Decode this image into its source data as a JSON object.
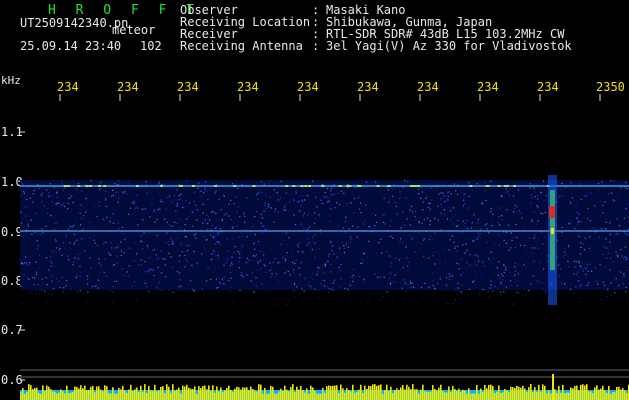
{
  "header": {
    "brand": "H R O F F T",
    "filename": "UT2509142340.pn",
    "filetype": "meteor",
    "datetime": "25.09.14 23:40",
    "count": "102"
  },
  "metadata": [
    {
      "key": "Observer",
      "sep": ":",
      "value": "Masaki Kano"
    },
    {
      "key": "Receiving Location",
      "sep": ":",
      "value": "Shibukawa, Gunma, Japan"
    },
    {
      "key": "Receiver",
      "sep": ":",
      "value": "RTL-SDR SDR# 43dB L15 103.2MHz CW"
    },
    {
      "key": "Receiving Antenna",
      "sep": ":",
      "value": "3el Yagi(V) Az 330 for Vladivostok"
    }
  ],
  "axis": {
    "unit": "kHz",
    "x_ticks": [
      "234",
      "234",
      "234",
      "234",
      "234",
      "234",
      "234",
      "234",
      "234",
      "2350"
    ],
    "y_ticks": [
      "1.1",
      "1.0",
      "0.9",
      "0.8",
      "0.7",
      "0.6"
    ]
  },
  "colors": {
    "header_text": "#e8e8e8",
    "brand": "#22e022",
    "tick_text": "#f2e000",
    "noise_low": "#0a1fa0",
    "noise_mid": "#2f6cff",
    "line": "#4fb9ff",
    "meteor": "#d03020",
    "power": "#f0e800"
  }
}
